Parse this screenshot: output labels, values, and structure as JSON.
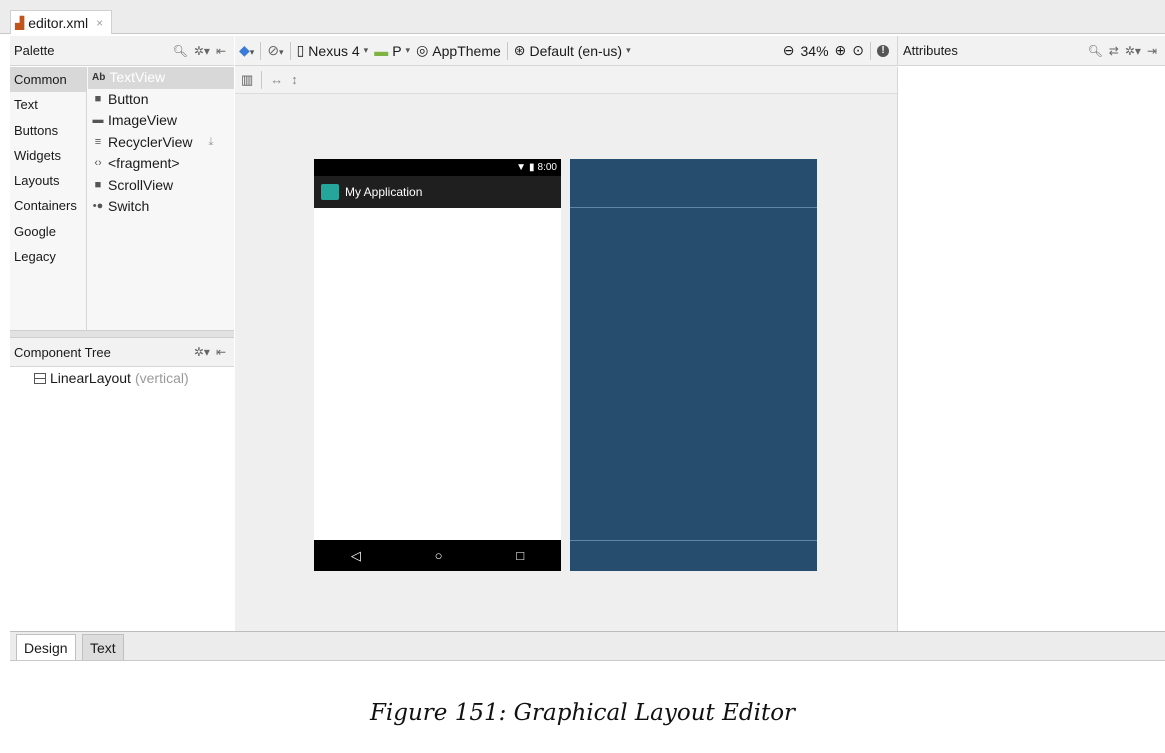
{
  "editor_tab": {
    "icon": "xml-file-icon",
    "label": "editor.xml",
    "close": "×"
  },
  "palette": {
    "title": "Palette",
    "categories": [
      "Common",
      "Text",
      "Buttons",
      "Widgets",
      "Layouts",
      "Containers",
      "Google",
      "Legacy"
    ],
    "selected_category": "Common",
    "items": [
      {
        "icon": "Ab",
        "label": "TextView"
      },
      {
        "icon": "■",
        "label": "Button"
      },
      {
        "icon": "▬",
        "label": "ImageView"
      },
      {
        "icon": "≡",
        "label": "RecyclerView"
      },
      {
        "icon": "‹›",
        "label": "<fragment>"
      },
      {
        "icon": "■",
        "label": "ScrollView"
      },
      {
        "icon": "•●",
        "label": "Switch"
      }
    ]
  },
  "component_tree": {
    "title": "Component Tree",
    "node_label": "LinearLayout",
    "node_hint": "(vertical)"
  },
  "toolbar": {
    "device": "Nexus 4",
    "api": "P",
    "theme": "AppTheme",
    "locale": "Default (en-us)",
    "zoom": "34%"
  },
  "phone": {
    "time": "8:00",
    "app_title": "My Application"
  },
  "attributes": {
    "title": "Attributes"
  },
  "bottom_tabs": {
    "design": "Design",
    "text": "Text"
  },
  "caption": "Figure 151: Graphical Layout Editor",
  "colors": {
    "accent_teal": "#26a69a",
    "blueprint": "#264d6e",
    "status_black": "#000000"
  }
}
